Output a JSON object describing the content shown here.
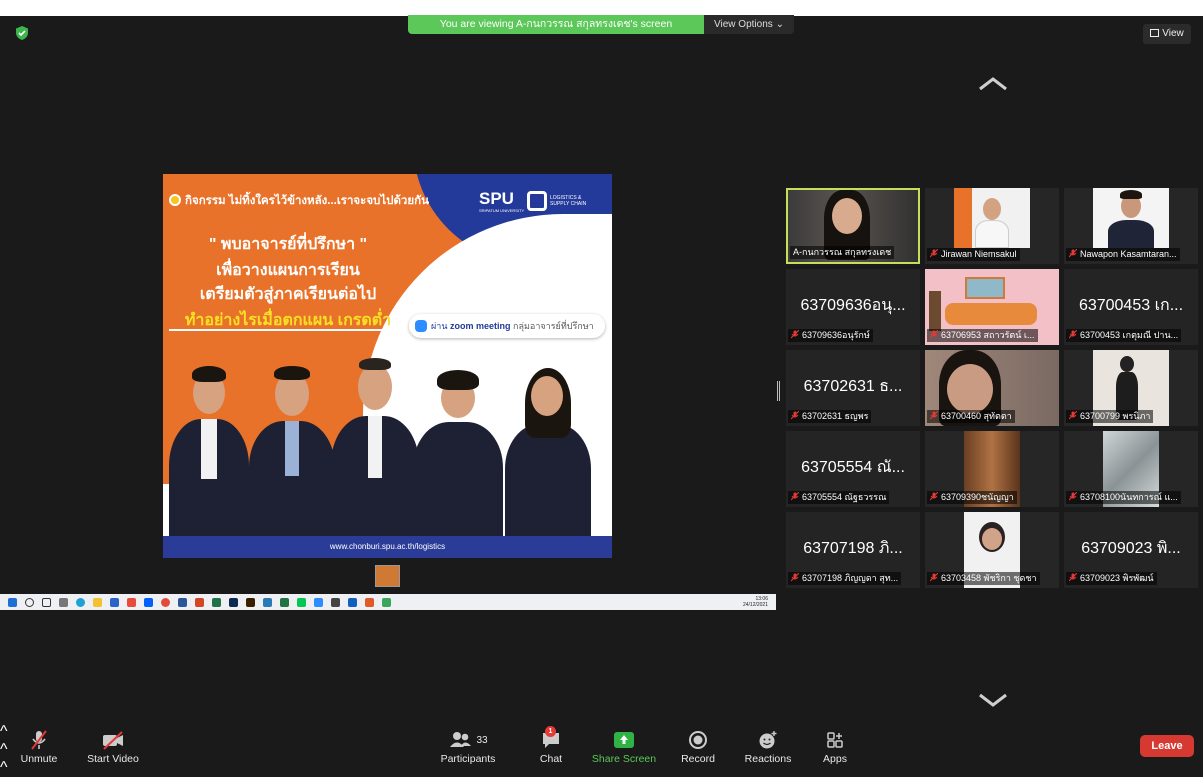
{
  "banner": {
    "viewing": "You are viewing A-กนกวรรณ สกุลทรงเดช's screen",
    "view_options": "View Options"
  },
  "view_button": "View",
  "poster": {
    "activity": "กิจกรรม ไม่ทิ้งใครไว้ข้างหลัง...เราจะจบไปด้วยกัน",
    "brand": "SPU",
    "brand_sub": "SRIPATUM UNIVERSITY",
    "lsc_line1": "LOGISTICS &",
    "lsc_line2": "SUPPLY CHAIN",
    "headline1": "\" พบอาจารย์ที่ปรึกษา \"",
    "headline2": "เพื่อวางแผนการเรียน",
    "headline3": "เตรียมตัวสู่ภาคเรียนต่อไป",
    "headline4": "ทำอย่างไรเมื่อตกแผน เกรดต่ำ",
    "zoom_prefix": "ผ่าน",
    "zoom_name": "zoom meeting",
    "zoom_suffix": "กลุ่มอาจารย์ที่ปรึกษา",
    "url": "www.chonburi.spu.ac.th/logistics"
  },
  "taskbar": {
    "time": "13:06",
    "date": "24/12/2021"
  },
  "participants": [
    {
      "label": "A-กนกวรรณ สกุลทรงเดช",
      "big": "",
      "type": "video",
      "active": true,
      "muted": false
    },
    {
      "label": "Jirawan Niemsakul",
      "big": "",
      "type": "video",
      "active": false,
      "muted": true
    },
    {
      "label": "Nawapon Kasamtaran...",
      "big": "",
      "type": "video",
      "active": false,
      "muted": true
    },
    {
      "label": "63709636อนุรักษ์",
      "big": "63709636อนุ...",
      "type": "name",
      "active": false,
      "muted": true
    },
    {
      "label": "63706953 สถาวรัตน์ เ...",
      "big": "",
      "type": "video",
      "active": false,
      "muted": true
    },
    {
      "label": "63700453 เกตุมณี ปาน...",
      "big": "63700453 เก...",
      "type": "name",
      "active": false,
      "muted": true
    },
    {
      "label": "63702631 ธญพร",
      "big": "63702631 ธ...",
      "type": "name",
      "active": false,
      "muted": true
    },
    {
      "label": "63700460 สุทัตตา",
      "big": "",
      "type": "video",
      "active": false,
      "muted": true
    },
    {
      "label": "63700799 พรนิภา",
      "big": "",
      "type": "video",
      "active": false,
      "muted": true
    },
    {
      "label": "63705554 ณัฐธวรรณ",
      "big": "63705554 ณั...",
      "type": "name",
      "active": false,
      "muted": true
    },
    {
      "label": "63709390ชนัญญา",
      "big": "",
      "type": "video",
      "active": false,
      "muted": true
    },
    {
      "label": "63708100นันทการณ์ แ...",
      "big": "",
      "type": "video",
      "active": false,
      "muted": true
    },
    {
      "label": "63707198 ภิญญดา สุท...",
      "big": "63707198 ภิ...",
      "type": "name",
      "active": false,
      "muted": true
    },
    {
      "label": "63703458 พัชริกา ชุดชา",
      "big": "",
      "type": "video",
      "active": false,
      "muted": true
    },
    {
      "label": "63709023 พิรพัฒน์",
      "big": "63709023 พิ...",
      "type": "name",
      "active": false,
      "muted": true
    }
  ],
  "toolbar": {
    "unmute": "Unmute",
    "start_video": "Start Video",
    "participants": "Participants",
    "participants_count": "33",
    "chat": "Chat",
    "chat_badge": "1",
    "share_screen": "Share Screen",
    "record": "Record",
    "reactions": "Reactions",
    "apps": "Apps",
    "leave": "Leave"
  },
  "colors": {
    "share_green": "#5cc85a",
    "active_border": "#c6de5a",
    "leave_red": "#d63832"
  }
}
